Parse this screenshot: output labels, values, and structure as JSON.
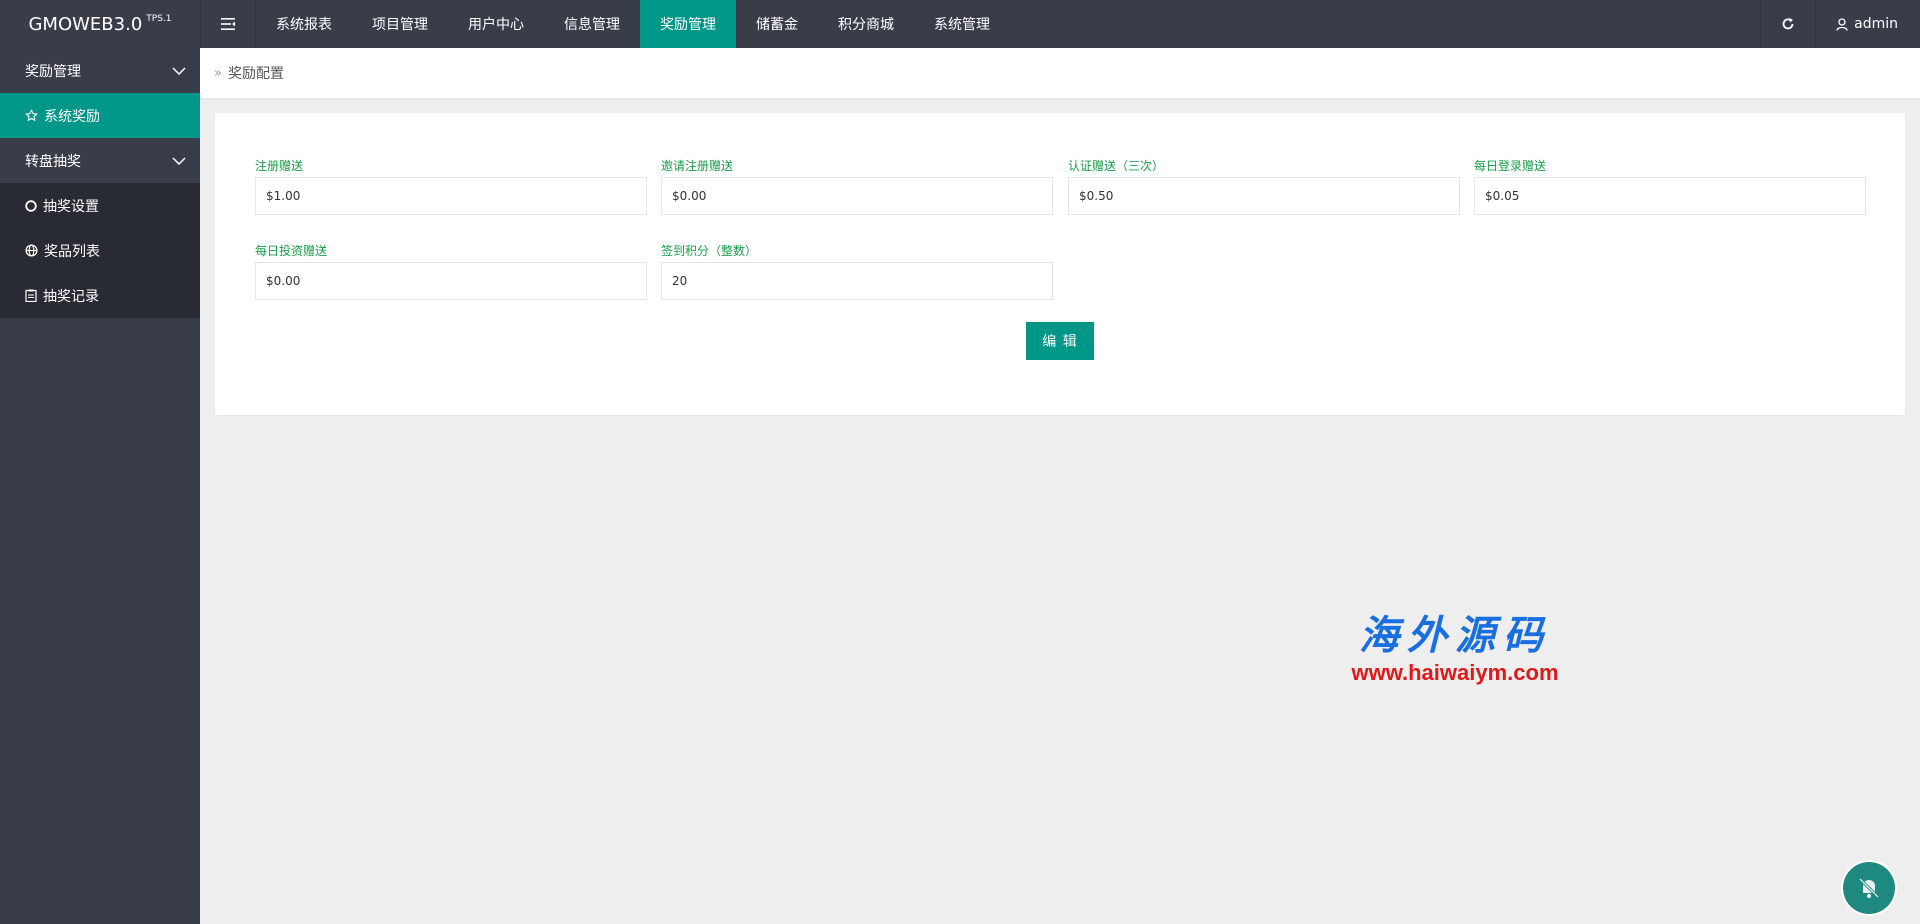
{
  "header": {
    "logo": "GMOWEB3.0",
    "logo_sup": "TPS.1",
    "nav": [
      {
        "label": "系统报表"
      },
      {
        "label": "项目管理"
      },
      {
        "label": "用户中心"
      },
      {
        "label": "信息管理"
      },
      {
        "label": "奖励管理"
      },
      {
        "label": "储蓄金"
      },
      {
        "label": "积分商城"
      },
      {
        "label": "系统管理"
      }
    ],
    "active_nav": "奖励管理",
    "user": "admin"
  },
  "sidebar": {
    "groups": [
      {
        "label": "奖励管理",
        "items": [
          {
            "label": "系统奖励",
            "icon": "star-icon"
          }
        ]
      },
      {
        "label": "转盘抽奖",
        "items": [
          {
            "label": "抽奖设置",
            "icon": "circle-icon"
          },
          {
            "label": "奖品列表",
            "icon": "globe-icon"
          },
          {
            "label": "抽奖记录",
            "icon": "clipboard-icon"
          }
        ]
      }
    ],
    "active_item": "系统奖励"
  },
  "breadcrumb": {
    "current": "奖励配置"
  },
  "form": {
    "fields": [
      {
        "label": "注册赠送",
        "value": "$1.00"
      },
      {
        "label": "邀请注册赠送",
        "value": "$0.00"
      },
      {
        "label": "认证赠送（三次）",
        "value": "$0.50"
      },
      {
        "label": "每日登录赠送",
        "value": "$0.05"
      },
      {
        "label": "每日投资赠送",
        "value": "$0.00"
      },
      {
        "label": "签到积分（整数）",
        "value": "20"
      }
    ],
    "submit_label": "编 辑"
  },
  "watermark": {
    "title": "海外源码",
    "url": "www.haiwaiym.com"
  },
  "colors": {
    "header_bg": "#393d49",
    "accent": "#009688",
    "label_green": "#1aa049",
    "sidebar_sub_bg": "#282b33"
  }
}
